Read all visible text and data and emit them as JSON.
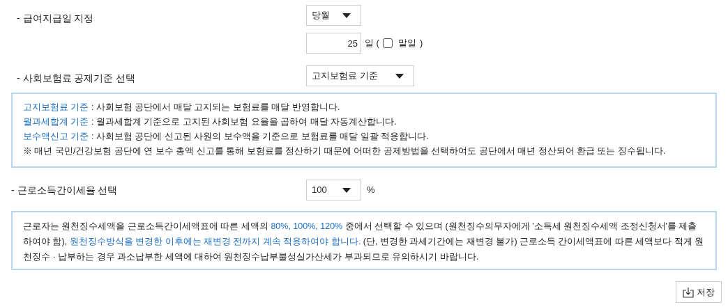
{
  "pay_day": {
    "label": "- 급여지급일 지정",
    "month_select": "당월",
    "day_value": "25",
    "day_unit": "일 (",
    "last_day": {
      "label": "말일",
      "checked": false
    },
    "close_paren": ")"
  },
  "insurance": {
    "label": "- 사회보험료 공제기준 선택",
    "select": "고지보험료 기준",
    "info": [
      {
        "term": "고지보험료 기준",
        "text": " : 사회보험 공단에서 매달 고지되는 보험료를 매달 반영합니다."
      },
      {
        "term": "월과세합계 기준",
        "text": " : 월과세합계 기준으로 고지된 사회보험 요율을 곱하여 매달 자동계산합니다."
      },
      {
        "term": "보수액신고 기준",
        "text": " : 사회보험 공단에 신고된 사원의 보수액을 기준으로 보험료를 매달 일괄 적용합니다."
      }
    ],
    "note": "※ 매년 국민/건강보험 공단에 연 보수 총액 신고를 통해 보험료를 정산하기 때문에 어떠한 공제방법을 선택하여도 공단에서 매년 정산되어 환급 또는 징수됩니다."
  },
  "tax_rate": {
    "label": "- 근로소득간이세율 선택",
    "select": "100",
    "unit": "%",
    "info": [
      {
        "kind": "plain",
        "text": "근로자는 원천징수세액을 근로소득간이세액표에 따른 세액의 "
      },
      {
        "kind": "highlight",
        "text": "80%, 100%, 120%"
      },
      {
        "kind": "plain",
        "text": " 중에서 선택할 수 있으며 (원천징수의무자에게 '소득세 원천징수세액 조정신청서'를 제출하여야 함), "
      },
      {
        "kind": "highlight",
        "text": "원천징수방식을 변경한 이후에는 재변경 전까지 계속 적용하여야 합니다."
      },
      {
        "kind": "plain",
        "text": " (단, 변경한 과세기간에는 재변경 불가) 근로소득 간이세액표에 따른 세액보다 적게 원천징수 · 납부하는 경우 과소납부한 세액에 대하여 원천징수납부불성실가산세가 부과되므로 유의하시기 바랍니다."
      }
    ]
  },
  "save_button": "저장"
}
